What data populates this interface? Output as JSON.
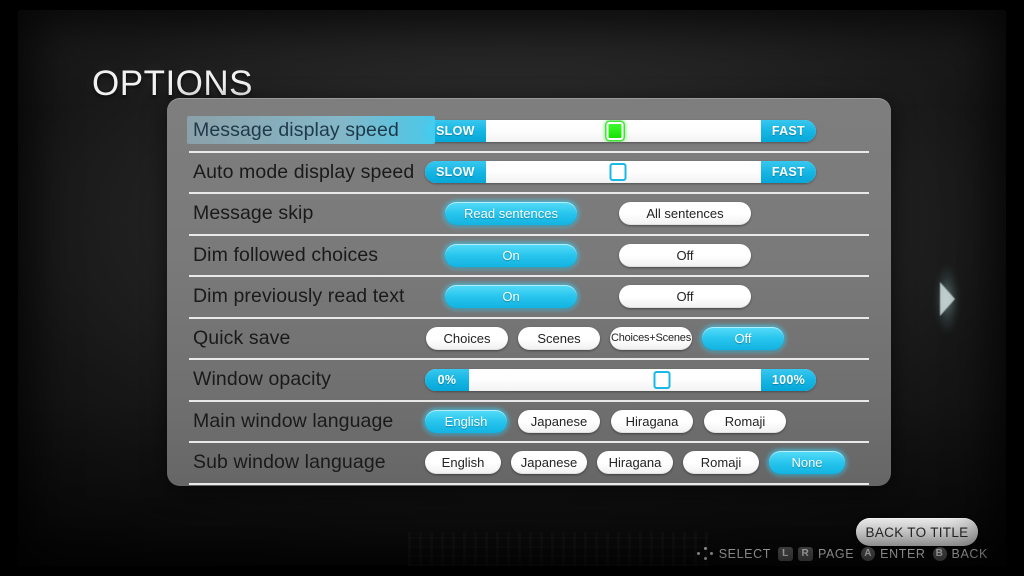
{
  "page": {
    "title": "OPTIONS",
    "page_arrow_icon": "chevron-right-icon"
  },
  "options": {
    "rows": [
      {
        "id": "message-display-speed",
        "label": "Message display speed",
        "type": "slider",
        "selected": true,
        "min_label": "SLOW",
        "max_label": "FAST",
        "value_percent": 47
      },
      {
        "id": "auto-mode-display-speed",
        "label": "Auto mode display speed",
        "type": "slider",
        "selected": false,
        "min_label": "SLOW",
        "max_label": "FAST",
        "value_percent": 48
      },
      {
        "id": "message-skip",
        "label": "Message skip",
        "type": "choices-2",
        "selected": false,
        "choices": [
          {
            "label": "Read sentences",
            "selected": true
          },
          {
            "label": "All sentences",
            "selected": false
          }
        ]
      },
      {
        "id": "dim-followed-choices",
        "label": "Dim followed choices",
        "type": "choices-2",
        "selected": false,
        "choices": [
          {
            "label": "On",
            "selected": true
          },
          {
            "label": "Off",
            "selected": false
          }
        ]
      },
      {
        "id": "dim-previously-read-text",
        "label": "Dim previously read text",
        "type": "choices-2",
        "selected": false,
        "choices": [
          {
            "label": "On",
            "selected": true
          },
          {
            "label": "Off",
            "selected": false
          }
        ]
      },
      {
        "id": "quick-save",
        "label": "Quick save",
        "type": "choices-4",
        "selected": false,
        "choices": [
          {
            "label": "Choices",
            "selected": false
          },
          {
            "label": "Scenes",
            "selected": false
          },
          {
            "label": "Choices+Scenes",
            "selected": false,
            "narrow": true
          },
          {
            "label": "Off",
            "selected": true
          }
        ]
      },
      {
        "id": "window-opacity",
        "label": "Window opacity",
        "type": "slider",
        "selected": false,
        "min_label": "0%",
        "max_label": "100%",
        "value_percent": 66
      },
      {
        "id": "main-window-language",
        "label": "Main window language",
        "type": "choices-lang4",
        "selected": false,
        "choices": [
          {
            "label": "English",
            "selected": true
          },
          {
            "label": "Japanese",
            "selected": false
          },
          {
            "label": "Hiragana",
            "selected": false
          },
          {
            "label": "Romaji",
            "selected": false
          }
        ]
      },
      {
        "id": "sub-window-language",
        "label": "Sub window language",
        "type": "choices-lang5",
        "selected": false,
        "choices": [
          {
            "label": "English",
            "selected": false
          },
          {
            "label": "Japanese",
            "selected": false
          },
          {
            "label": "Hiragana",
            "selected": false
          },
          {
            "label": "Romaji",
            "selected": false
          },
          {
            "label": "None",
            "selected": true
          }
        ]
      }
    ]
  },
  "footer": {
    "back_to_title_label": "BACK TO TITLE",
    "hints": [
      {
        "icon": "dpad-icon",
        "keys": [],
        "label": "SELECT"
      },
      {
        "icon": "",
        "keys": [
          "L",
          "R"
        ],
        "label": "PAGE"
      },
      {
        "icon": "",
        "keys": [
          "A"
        ],
        "label": "ENTER"
      },
      {
        "icon": "",
        "keys": [
          "B"
        ],
        "label": "BACK"
      }
    ]
  },
  "colors": {
    "accent_cyan": "#19b9e6",
    "accent_green": "#22e810",
    "panel_grey": "#7a7a7a",
    "divider": "#e9e9e9"
  }
}
